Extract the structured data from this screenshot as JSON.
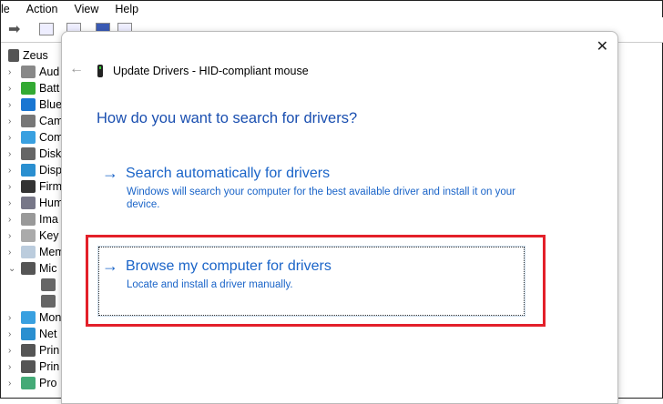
{
  "menu": [
    "le",
    "Action",
    "View",
    "Help"
  ],
  "tree": {
    "root": "Zeus",
    "items": [
      {
        "label": "Aud",
        "color": "#888",
        "expanded": false
      },
      {
        "label": "Batt",
        "color": "#3a3",
        "expanded": false
      },
      {
        "label": "Blue",
        "color": "#1976d2",
        "expanded": false
      },
      {
        "label": "Cam",
        "color": "#777",
        "expanded": false
      },
      {
        "label": "Com",
        "color": "#39a0e0",
        "expanded": false
      },
      {
        "label": "Disk",
        "color": "#666",
        "expanded": false
      },
      {
        "label": "Disp",
        "color": "#2a8fd0",
        "expanded": false
      },
      {
        "label": "Firm",
        "color": "#333",
        "expanded": false
      },
      {
        "label": "Hum",
        "color": "#778",
        "expanded": false
      },
      {
        "label": "Ima",
        "color": "#999",
        "expanded": false
      },
      {
        "label": "Key",
        "color": "#aaa",
        "expanded": false
      },
      {
        "label": "Mem",
        "color": "#bcd",
        "expanded": false
      },
      {
        "label": "Mic",
        "color": "#555",
        "expanded": true
      }
    ],
    "children": [
      "",
      ""
    ],
    "items2": [
      {
        "label": "Mon",
        "color": "#39a0e0"
      },
      {
        "label": "Net",
        "color": "#2a8fd0"
      },
      {
        "label": "Prin",
        "color": "#555"
      },
      {
        "label": "Prin",
        "color": "#555"
      },
      {
        "label": "Pro",
        "color": "#4a7"
      }
    ]
  },
  "dialog": {
    "title": "Update Drivers - HID-compliant mouse",
    "question": "How do you want to search for drivers?",
    "option1": {
      "heading": "Search automatically for drivers",
      "desc": "Windows will search your computer for the best available driver and install it on your device."
    },
    "option2": {
      "heading": "Browse my computer for drivers",
      "desc": "Locate and install a driver manually."
    },
    "close": "✕",
    "back": "←",
    "arrow": "→"
  }
}
